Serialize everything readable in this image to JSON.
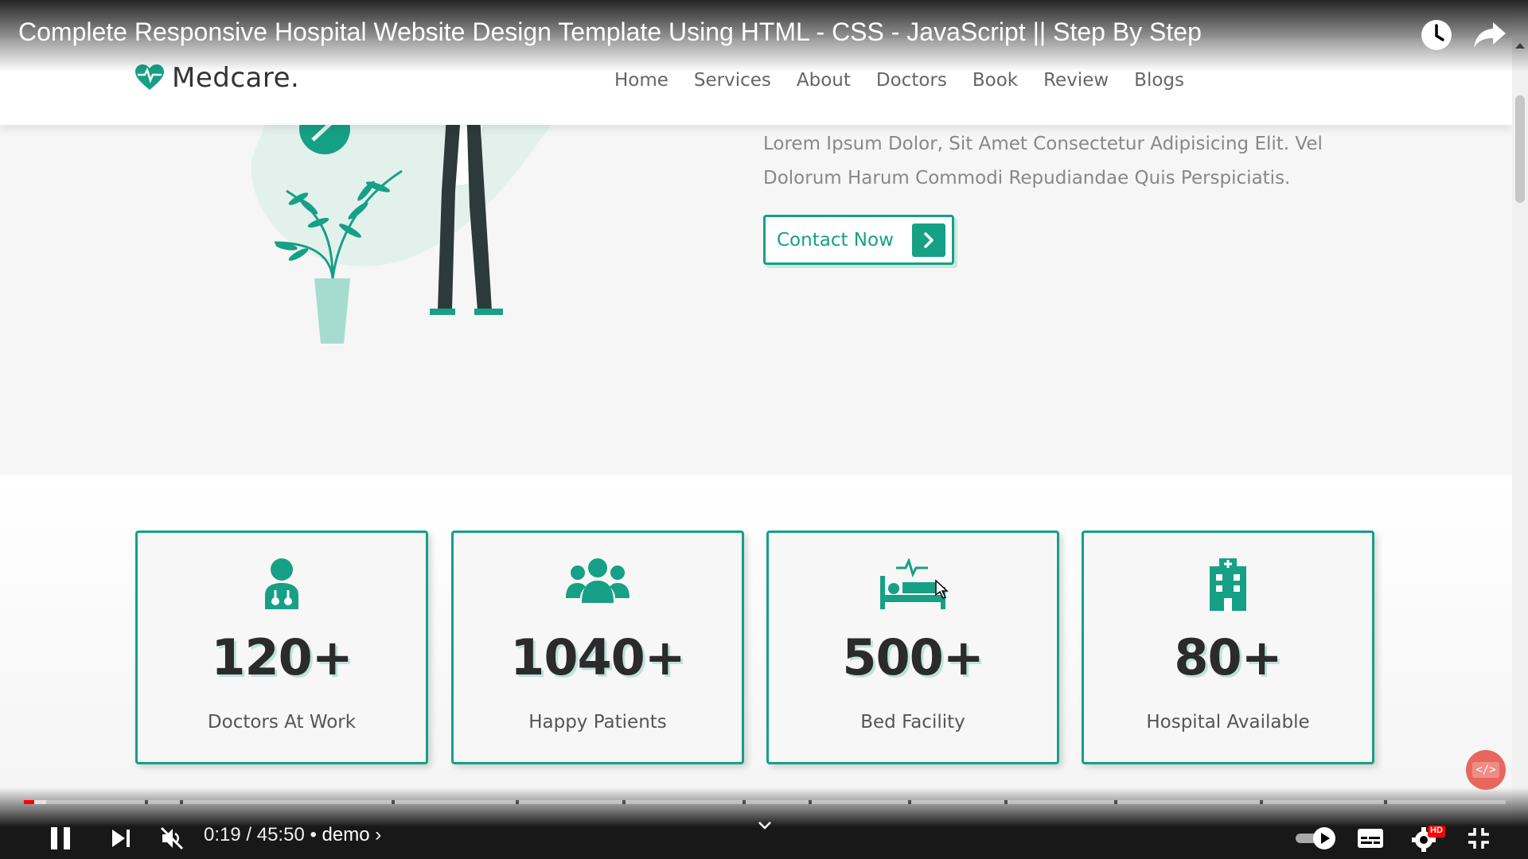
{
  "video": {
    "title": "Complete Responsive Hospital Website Design Template Using HTML - CSS - JavaScript || Step By Step",
    "current_time": "0:19",
    "duration": "45:50",
    "chapter": "demo",
    "progress_fraction": 0.0069,
    "buffered_fraction": 0.015,
    "muted": true,
    "quality_badge": "HD",
    "accent_color": "#ff0000"
  },
  "site": {
    "logo_text": "Medcare.",
    "brand_color": "#16a085",
    "nav": [
      "Home",
      "Services",
      "About",
      "Doctors",
      "Book",
      "Review",
      "Blogs"
    ],
    "hero": {
      "paragraph_line1": "Lorem Ipsum Dolor, Sit Amet Consectetur Adipisicing Elit. Vel",
      "paragraph_line2": "Dolorum Harum Commodi Repudiandae Quis Perspiciatis.",
      "button_label": "Contact Now"
    },
    "stats": [
      {
        "icon": "doctor-icon",
        "count": "120+",
        "label": "Doctors At Work"
      },
      {
        "icon": "users-icon",
        "count": "1040+",
        "label": "Happy Patients"
      },
      {
        "icon": "bed-icon",
        "count": "500+",
        "label": "Bed Facility"
      },
      {
        "icon": "hospital-icon",
        "count": "80+",
        "label": "Hospital Available"
      }
    ]
  },
  "badge": {
    "text": "</>"
  }
}
